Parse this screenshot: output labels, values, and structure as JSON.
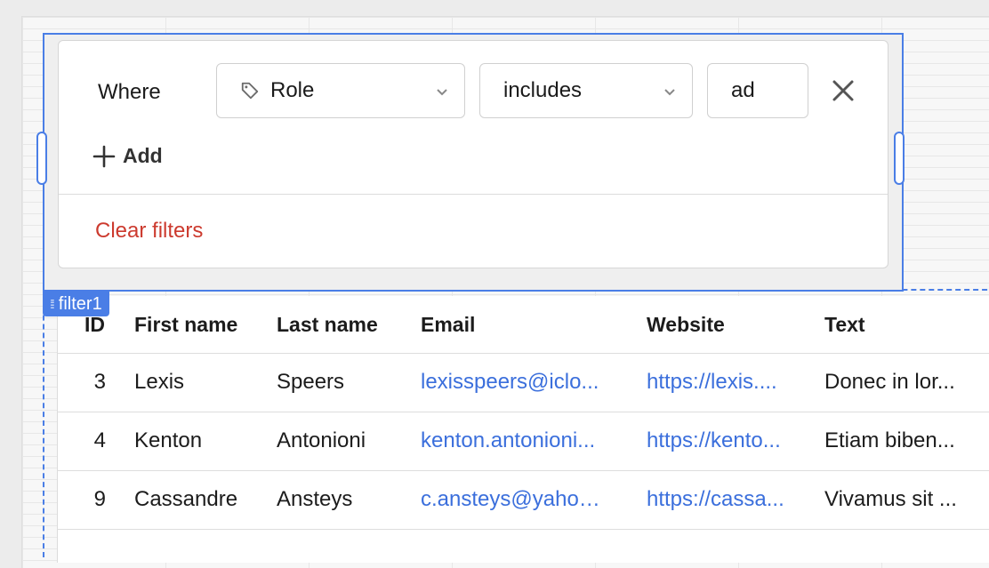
{
  "filter": {
    "where_label": "Where",
    "field": "Role",
    "operator": "includes",
    "value": "ad",
    "add_label": "Add",
    "clear_label": "Clear filters",
    "component_tag": "filter1"
  },
  "table": {
    "columns": [
      "ID",
      "First name",
      "Last name",
      "Email",
      "Website",
      "Text"
    ],
    "rows": [
      {
        "id": "3",
        "first": "Lexis",
        "last": "Speers",
        "email": "lexisspeers@iclo...",
        "website": "https://lexis....",
        "text": "Donec in lor..."
      },
      {
        "id": "4",
        "first": "Kenton",
        "last": "Antonioni",
        "email": "kenton.antonioni...",
        "website": "https://kento...",
        "text": "Etiam biben..."
      },
      {
        "id": "9",
        "first": "Cassandre",
        "last": "Ansteys",
        "email": "c.ansteys@yahoo...",
        "website": "https://cassa...",
        "text": "Vivamus sit ..."
      }
    ]
  },
  "colors": {
    "selection": "#4a7ee6",
    "link": "#3b6fdc",
    "danger": "#cc3a2e"
  },
  "icons": [
    "tag-icon",
    "chevron-down-icon",
    "close-icon",
    "plus-icon",
    "drag-grip-icon"
  ]
}
